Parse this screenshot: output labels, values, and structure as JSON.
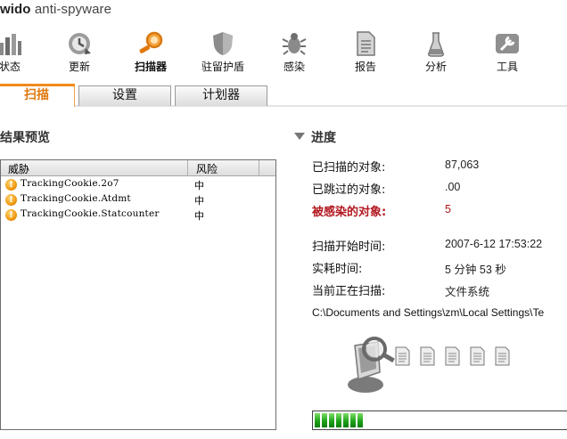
{
  "app": {
    "title_prefix": "wido",
    "title_rest": " anti-spyware"
  },
  "toolbar": [
    {
      "label": "状态",
      "icon": "status-icon",
      "active": false
    },
    {
      "label": "更新",
      "icon": "update-icon",
      "active": false
    },
    {
      "label": "扫描器",
      "icon": "scanner-icon",
      "active": true
    },
    {
      "label": "驻留护盾",
      "icon": "shield-icon",
      "active": false
    },
    {
      "label": "感染",
      "icon": "bug-icon",
      "active": false
    },
    {
      "label": "报告",
      "icon": "report-icon",
      "active": false
    },
    {
      "label": "分析",
      "icon": "analysis-icon",
      "active": false
    },
    {
      "label": "工具",
      "icon": "tools-icon",
      "active": false
    }
  ],
  "tabs": [
    {
      "label": "扫描",
      "active": true
    },
    {
      "label": "设置",
      "active": false
    },
    {
      "label": "计划器",
      "active": false
    }
  ],
  "results": {
    "title": "结果预览",
    "columns": [
      "威胁",
      "风险"
    ],
    "rows": [
      {
        "name": "TrackingCookie.2o7",
        "risk": "中"
      },
      {
        "name": "TrackingCookie.Atdmt",
        "risk": "中"
      },
      {
        "name": "TrackingCookie.Statcounter",
        "risk": "中"
      }
    ]
  },
  "progress": {
    "title": "进度",
    "scanned_label": "已扫描的对象:",
    "scanned_value": "87,063",
    "skipped_label": "已跳过的对象:",
    "skipped_value": ".00",
    "infected_label": "被感染的对象:",
    "infected_value": "5",
    "start_label": "扫描开始时间:",
    "start_value": "2007-6-12 17:53:22",
    "elapsed_label": "实耗时间:",
    "elapsed_value": "5 分钟 53 秒",
    "current_label": "当前正在扫描:",
    "current_value": "文件系统",
    "path": "C:\\Documents and Settings\\zm\\Local Settings\\Te",
    "bar_segments": 7
  },
  "colors": {
    "accent": "#f08a1c",
    "danger": "#b2171f",
    "progress": "#1fa31a"
  }
}
